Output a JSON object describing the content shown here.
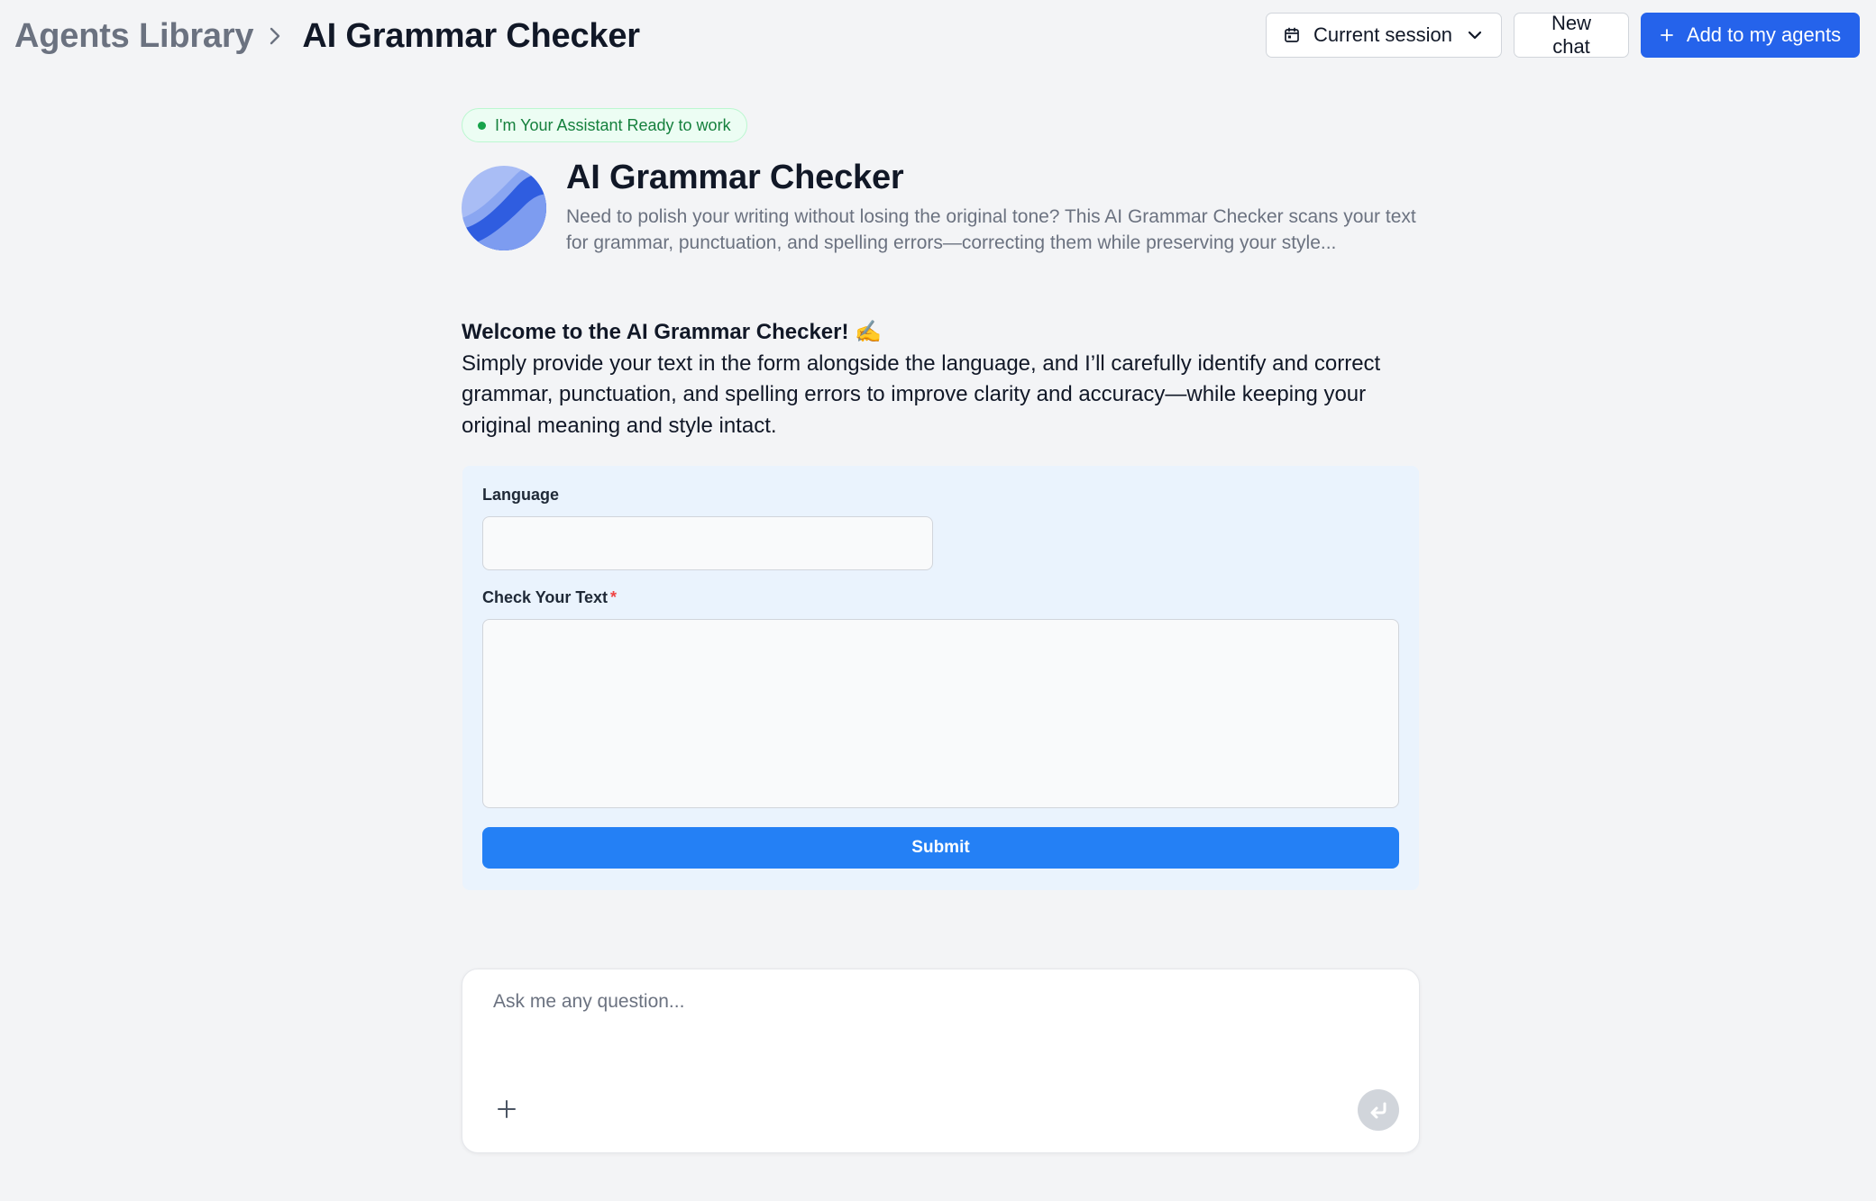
{
  "breadcrumb": {
    "root": "Agents Library",
    "current": "AI Grammar Checker"
  },
  "header": {
    "session_label": "Current session",
    "new_chat_label": "New chat",
    "add_label": "Add to my agents"
  },
  "status": {
    "text": "I'm Your Assistant Ready to work"
  },
  "agent": {
    "name": "AI Grammar Checker",
    "description": "Need to polish your writing without losing the original tone? This AI Grammar Checker scans your text for grammar, punctuation, and spelling errors—correcting them while preserving your style..."
  },
  "welcome": {
    "title": "Welcome to the AI Grammar Checker! ✍️",
    "body": "Simply provide your text in the form alongside the language, and I’ll carefully identify and correct grammar, punctuation, and spelling errors to improve clarity and accuracy—while keeping your original meaning and style intact."
  },
  "form": {
    "language_label": "Language",
    "language_value": "",
    "text_label": "Check Your Text",
    "required_mark": "*",
    "text_value": "",
    "submit_label": "Submit"
  },
  "chat": {
    "placeholder": "Ask me any question..."
  },
  "icons": {
    "session": "calendar-icon",
    "dropdown": "chevron-down-icon",
    "add": "plus-icon",
    "breadcrumb_sep": "chevron-right-icon",
    "attach": "plus-icon",
    "send": "enter-return-icon"
  },
  "colors": {
    "primary": "#2563eb",
    "submit": "#2480f5",
    "status_green": "#16a34a",
    "form_bg": "#eaf3fd",
    "page_bg": "#f3f4f6"
  }
}
